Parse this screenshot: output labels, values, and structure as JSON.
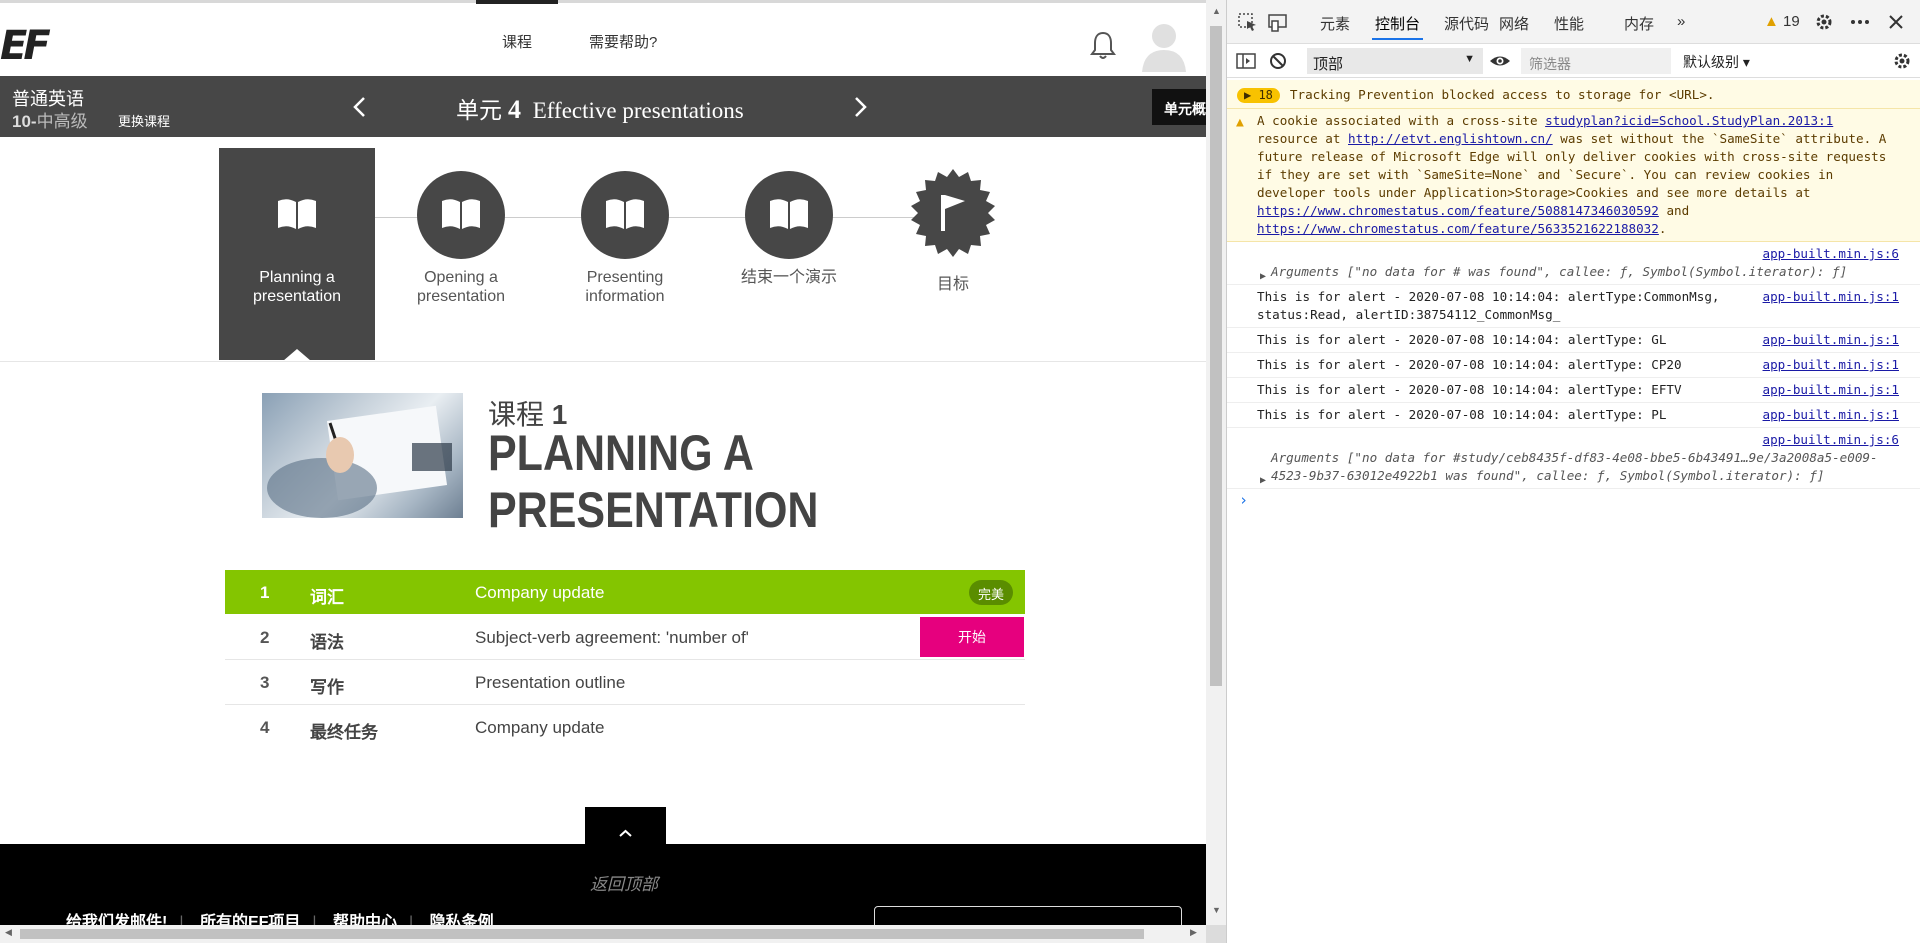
{
  "site": {
    "logo": "EF",
    "nav": [
      "课程",
      "需要帮助?"
    ]
  },
  "unit_bar": {
    "course_name": "普通英语",
    "level_num": "10-",
    "level_name": "中高级",
    "change_course": "更换课程",
    "unit_prefix": "单元",
    "unit_number": "4",
    "unit_title": "Effective presentations",
    "overview_button": "单元概"
  },
  "lesson_steps": [
    {
      "label": "Planning a presentation",
      "icon": "book-icon",
      "active": true
    },
    {
      "label": "Opening a presentation",
      "icon": "book-icon",
      "active": false
    },
    {
      "label": "Presenting information",
      "icon": "book-icon",
      "active": false
    },
    {
      "label": "结束一个演示",
      "icon": "book-icon",
      "active": false
    },
    {
      "label": "目标",
      "icon": "flag-icon",
      "active": false
    }
  ],
  "lesson": {
    "kicker": "课程",
    "number": "1",
    "title_line1": "PLANNING A",
    "title_line2": "PRESENTATION"
  },
  "activities": [
    {
      "num": "1",
      "type": "词汇",
      "name": "Company update",
      "status": "完美"
    },
    {
      "num": "2",
      "type": "语法",
      "name": "Subject-verb agreement: 'number of'",
      "status": "开始"
    },
    {
      "num": "3",
      "type": "写作",
      "name": "Presentation outline",
      "status": ""
    },
    {
      "num": "4",
      "type": "最终任务",
      "name": "Company update",
      "status": ""
    }
  ],
  "footer": {
    "back_to_top": "返回顶部",
    "links": [
      "给我们发邮件!",
      "所有的EF项目",
      "帮助中心",
      "隐私条例"
    ]
  },
  "devtools": {
    "tabs": [
      "元素",
      "控制台",
      "源代码",
      "网络",
      "性能",
      "内存"
    ],
    "active_tab": "控制台",
    "more": "»",
    "warning_count": "19",
    "context": "顶部",
    "filter_placeholder": "筛选器",
    "level": "默认级别 ▾",
    "messages": {
      "tracking_count": "18",
      "tracking_text": "Tracking Prevention blocked access to storage for <URL>.",
      "cookie_a": "A cookie associated with a cross-site ",
      "cookie_link1": "studyplan?icid=School.StudyPlan.2013:1",
      "cookie_b": " resource at ",
      "cookie_link2": "http://etvt.englishtown.cn/",
      "cookie_c": " was set without the `SameSite` attribute. A future release of Microsoft Edge will only deliver cookies with cross-site requests if they are set with `SameSite=None` and `Secure`. You can review cookies in developer tools under Application>Storage>Cookies and see more details at ",
      "cookie_link3": "https://www.chromestatus.com/feature/5088147346030592",
      "cookie_d": " and ",
      "cookie_link4": "https://www.chromestatus.com/feature/5633521622188032",
      "cookie_e": ".",
      "src6": "app-built.min.js:6",
      "src1": "app-built.min.js:1",
      "args1": "Arguments [\"no data for # was found\", callee: ƒ, Symbol(Symbol.iterator): ƒ]",
      "alert1": "This is for alert - 2020-07-08 10:14:04: alertType:CommonMsg, status:Read, alertID:38754112_CommonMsg_",
      "alert2": "This is for alert - 2020-07-08 10:14:04: alertType: GL",
      "alert3": "This is for alert - 2020-07-08 10:14:04: alertType: CP20",
      "alert4": "This is for alert - 2020-07-08 10:14:04: alertType: EFTV",
      "alert5": "This is for alert - 2020-07-08 10:14:04: alertType: PL",
      "args2": "Arguments [\"no data for #study/ceb8435f-df83-4e08-bbe5-6b43491…9e/3a2008a5-e009-4523-9b37-63012e4922b1 was found\", callee: ƒ, Symbol(Symbol.iterator): ƒ]",
      "prompt": "›"
    }
  },
  "colors": {
    "done_green": "#84c500",
    "start_pink": "#e6007e",
    "unit_bar": "#474747",
    "devtools_accent": "#1a73e8"
  }
}
